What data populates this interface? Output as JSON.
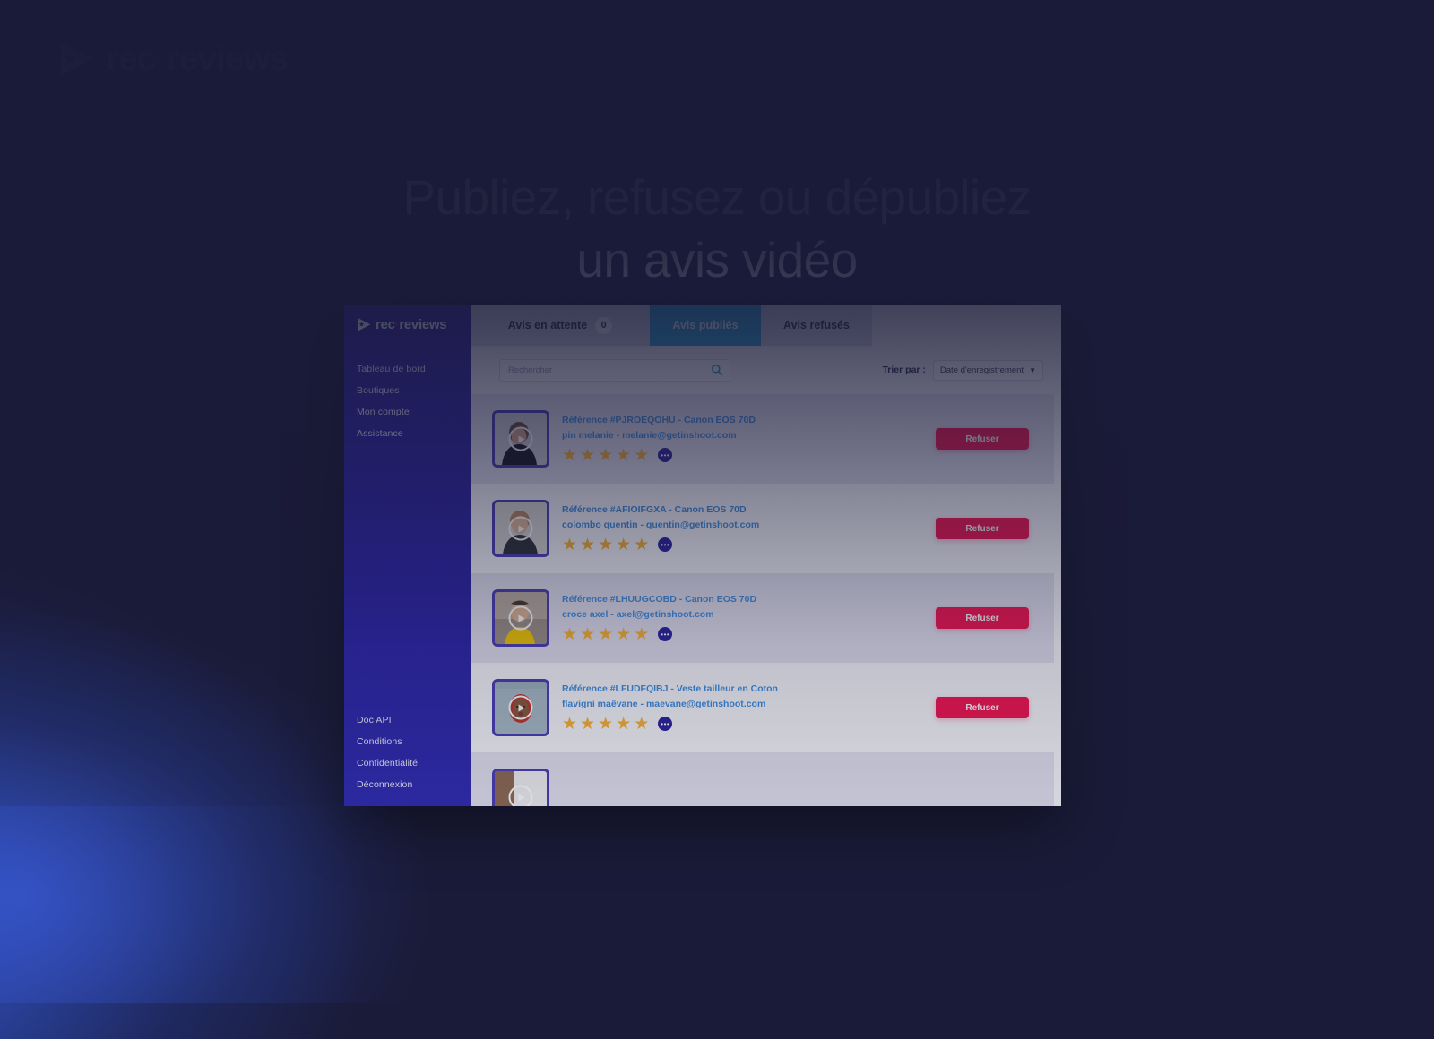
{
  "brand": {
    "name_main": "rec",
    "name_dot": "·",
    "name_rest": "reviews"
  },
  "headline": {
    "line1": "Publiez, refusez ou dépubliez",
    "line2": "un avis vidéo"
  },
  "colors": {
    "page_bg_dark": "#1a1b38",
    "page_glow_blue": "#2d48ac",
    "sidebar_purple": "#2a219e",
    "tab_active_cyan": "#25a6d9",
    "refuse_pink": "#f4134f",
    "star_gold": "#f9b233",
    "link_blue": "#3f8fe0",
    "row_alt_lavender": "#e2e1ef",
    "row_white": "#f7f7fb",
    "brand_dot_red": "#f0134d"
  },
  "app": {
    "sidebar": {
      "logo_main": "rec",
      "logo_dot": "·",
      "logo_rest": "reviews",
      "items": [
        {
          "label": "Tableau de bord"
        },
        {
          "label": "Boutiques"
        },
        {
          "label": "Mon compte"
        },
        {
          "label": "Assistance"
        }
      ],
      "bottom_items": [
        {
          "label": "Doc API"
        },
        {
          "label": "Conditions"
        },
        {
          "label": "Confidentialité"
        },
        {
          "label": "Déconnexion"
        }
      ]
    },
    "tabs": [
      {
        "label": "Avis en attente",
        "badge": "0",
        "active": false
      },
      {
        "label": "Avis publiés",
        "badge": null,
        "active": true
      },
      {
        "label": "Avis refusés",
        "badge": null,
        "active": false
      }
    ],
    "toolbar": {
      "search_placeholder": "Rechercher",
      "search_value": "",
      "search_icon": "search-icon",
      "sort_label": "Trier par :",
      "sort_value": "Date d'enregistrement",
      "sort_caret": "▼"
    },
    "reviews": [
      {
        "reference": "Référence #PJROEQOHU - Canon EOS 70D",
        "author": "pin melanie - melanie@getinshoot.com",
        "stars": 5,
        "more_label": "•••",
        "action_label": "Refuser"
      },
      {
        "reference": "Référence #AFIOIFGXA - Canon EOS 70D",
        "author": "colombo quentin - quentin@getinshoot.com",
        "stars": 5,
        "more_label": "•••",
        "action_label": "Refuser"
      },
      {
        "reference": "Référence #LHUUGCOBD - Canon EOS 70D",
        "author": "croce axel - axel@getinshoot.com",
        "stars": 5,
        "more_label": "•••",
        "action_label": "Refuser"
      },
      {
        "reference": "Référence #LFUDFQIBJ - Veste tailleur en Coton",
        "author": "flavigni maëvane - maevane@getinshoot.com",
        "stars": 5,
        "more_label": "•••",
        "action_label": "Refuser"
      },
      {
        "reference": "",
        "author": "",
        "stars": 0,
        "more_label": "",
        "action_label": ""
      }
    ]
  }
}
